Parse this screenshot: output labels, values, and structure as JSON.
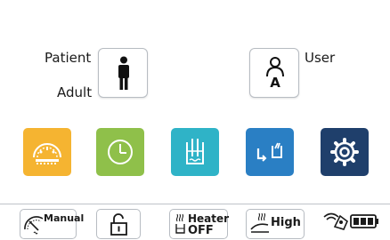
{
  "patient": {
    "label": "Patient",
    "type": "Adult"
  },
  "user": {
    "label": "User",
    "letter": "A"
  },
  "tiles": {
    "monitor_color": "#f5b431",
    "timer_color": "#8fc04a",
    "humidifier_color": "#2fb3c7",
    "return_color": "#2a7fc4",
    "settings_color": "#1f3f6b"
  },
  "status": {
    "mode_label": "Manual",
    "heater_label": "Heater",
    "heater_state": "OFF",
    "level_label": "High"
  },
  "icons": [
    "person-icon",
    "user-icon",
    "gauge-icon",
    "clock-icon",
    "humidifier-icon",
    "return-arrow-icon",
    "gear-icon",
    "unlock-icon",
    "wireless-icon",
    "battery-icon"
  ]
}
